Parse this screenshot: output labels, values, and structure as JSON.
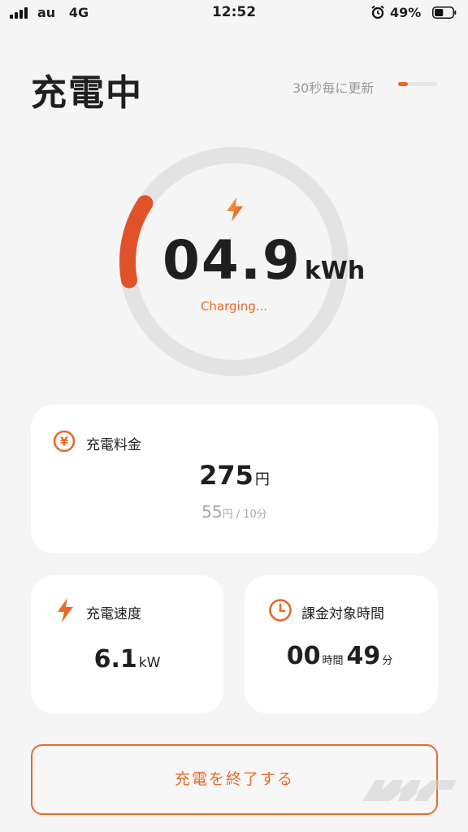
{
  "status_bar": {
    "carrier": "au",
    "network": "4G",
    "time": "12:52",
    "battery": "49%",
    "battery_level": 0.49,
    "icons": [
      "signal-icon",
      "alarm-icon",
      "battery-icon"
    ]
  },
  "header": {
    "title": "充電中",
    "update_label": "30秒毎に更新",
    "update_progress": 0.25
  },
  "gauge": {
    "value": "04.9",
    "unit": "kWh",
    "status": "Charging...",
    "progress": 0.12,
    "icon": "lightning-bolt-icon"
  },
  "fee": {
    "label": "充電料金",
    "amount": "275",
    "amount_unit": "円",
    "rate_value": "55",
    "rate_unit": "円 / 10分",
    "icon": "yen-icon"
  },
  "speed": {
    "label": "充電速度",
    "value": "6.1",
    "unit": "kW",
    "icon": "lightning-icon"
  },
  "billing_time": {
    "label": "課金対象時間",
    "hours": "00",
    "hours_unit": "時間",
    "minutes": "49",
    "minutes_unit": "分",
    "icon": "clock-icon"
  },
  "end_button": {
    "label": "充電を終了する"
  },
  "colors": {
    "accent": "#e8692a",
    "background": "#f5f5f5",
    "card": "#ffffff",
    "gauge_track": "#e3e3e3"
  }
}
